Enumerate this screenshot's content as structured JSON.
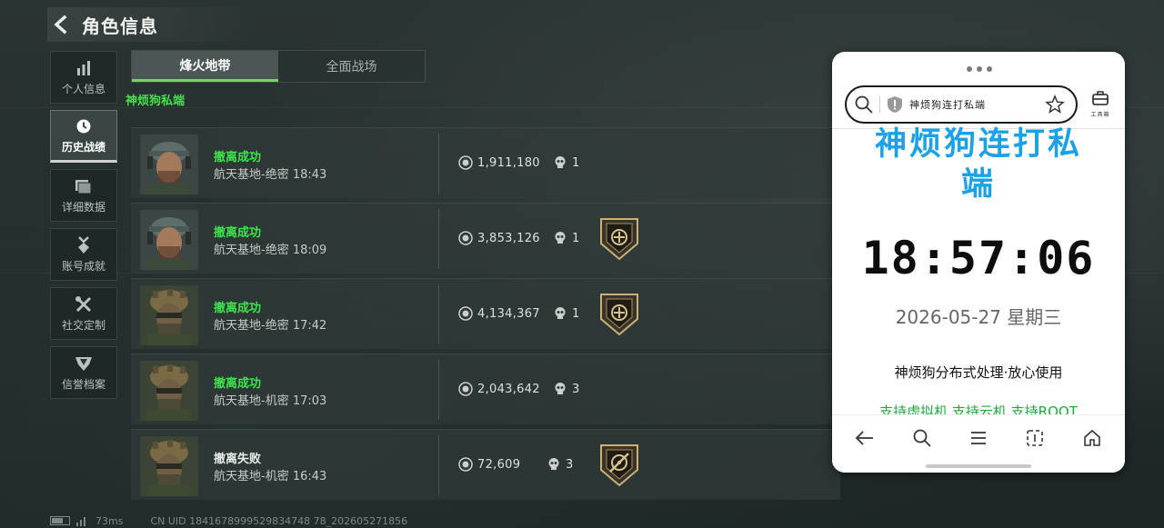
{
  "header": {
    "title": "角色信息"
  },
  "sidebar": {
    "items": [
      {
        "label": "个人信息",
        "icon": "bar-chart-icon",
        "active": false
      },
      {
        "label": "历史战绩",
        "icon": "clock-icon",
        "active": true
      },
      {
        "label": "详细数据",
        "icon": "folder-icon",
        "active": false
      },
      {
        "label": "账号成就",
        "icon": "medal-icon",
        "active": false
      },
      {
        "label": "社交定制",
        "icon": "tools-icon",
        "active": false
      },
      {
        "label": "信誉档案",
        "icon": "shield-badge-icon",
        "active": false
      }
    ]
  },
  "tabs": [
    {
      "label": "烽火地带",
      "active": true
    },
    {
      "label": "全面战场",
      "active": false
    }
  ],
  "overlay_label": "神烦狗私端",
  "matches": [
    {
      "status": "撤离成功",
      "success": true,
      "map": "航天基地-绝密 18:43",
      "value": "1,911,180",
      "kills": "1",
      "badge": "none",
      "avatar": "cap-operator"
    },
    {
      "status": "撤离成功",
      "success": true,
      "map": "航天基地-绝密 18:09",
      "value": "3,853,126",
      "kills": "1",
      "badge": "emblem-badge-icon",
      "avatar": "cap-operator"
    },
    {
      "status": "撤离成功",
      "success": true,
      "map": "航天基地-绝密 17:42",
      "value": "4,134,367",
      "kills": "1",
      "badge": "emblem-badge-icon",
      "avatar": "camo-operator"
    },
    {
      "status": "撤离成功",
      "success": true,
      "map": "航天基地-机密 17:03",
      "value": "2,043,642",
      "kills": "3",
      "badge": "none",
      "avatar": "camo-operator"
    },
    {
      "status": "撤离失败",
      "success": false,
      "map": "航天基地-机密 16:43",
      "value": "72,609",
      "kills": "3",
      "badge": "crosshair-badge-icon",
      "avatar": "camo-operator"
    }
  ],
  "statusbar": {
    "ping": "73ms",
    "uid": "CN UID 1841678999529834748 78_202605271856"
  },
  "phone": {
    "url_text": "神烦狗连打私端",
    "toolbox_label": "工具箱",
    "title": "神烦狗连打私端",
    "clock": "18:57:06",
    "date": "2026-05-27 星期三",
    "slogan": "神烦狗分布式处理·放心使用",
    "support": "支持虚拟机,支持云机,支持ROOT"
  },
  "colors": {
    "success": "#3ce64a",
    "accent_blue": "#1aa1e6",
    "support_green": "#1faa3c"
  }
}
